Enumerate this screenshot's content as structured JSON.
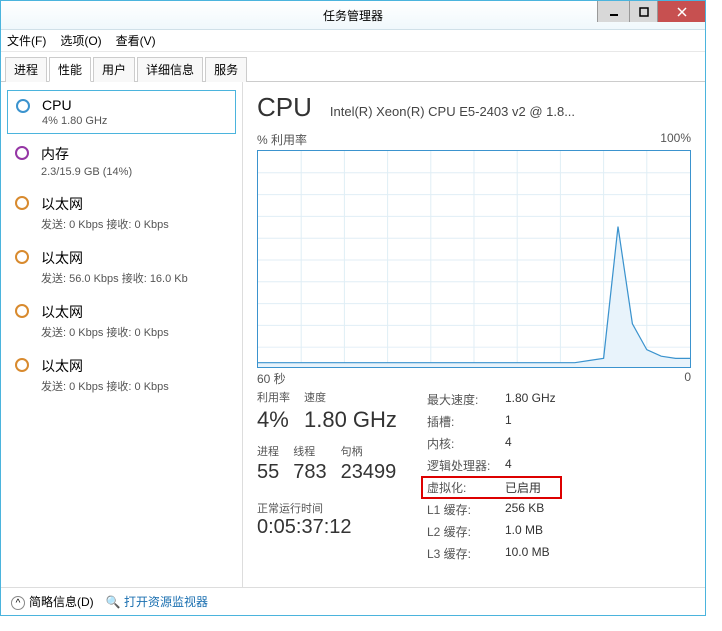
{
  "window": {
    "title": "任务管理器"
  },
  "menu": {
    "file": "文件(F)",
    "options": "选项(O)",
    "view": "查看(V)"
  },
  "tabs": {
    "processes": "进程",
    "performance": "性能",
    "users": "用户",
    "details": "详细信息",
    "services": "服务"
  },
  "sidebar": [
    {
      "title": "CPU",
      "sub": "4% 1.80 GHz",
      "iconClass": "cpu",
      "selected": true
    },
    {
      "title": "内存",
      "sub": "2.3/15.9 GB (14%)",
      "iconClass": "mem"
    },
    {
      "title": "以太网",
      "sub": "发送: 0 Kbps 接收: 0 Kbps",
      "iconClass": "eth"
    },
    {
      "title": "以太网",
      "sub": "发送: 56.0 Kbps 接收: 16.0 Kb",
      "iconClass": "eth"
    },
    {
      "title": "以太网",
      "sub": "发送: 0 Kbps 接收: 0 Kbps",
      "iconClass": "eth"
    },
    {
      "title": "以太网",
      "sub": "发送: 0 Kbps 接收: 0 Kbps",
      "iconClass": "eth"
    }
  ],
  "main": {
    "title": "CPU",
    "model": "Intel(R) Xeon(R) CPU E5-2403 v2 @ 1.8...",
    "chart_ylabel": "% 利用率",
    "chart_ymax": "100%",
    "chart_xlabel_left": "60 秒",
    "chart_xlabel_right": "0"
  },
  "stats": {
    "util_label": "利用率",
    "util": "4%",
    "speed_label": "速度",
    "speed": "1.80 GHz",
    "proc_label": "进程",
    "proc": "55",
    "threads_label": "线程",
    "threads": "783",
    "handles_label": "句柄",
    "handles": "23499",
    "uptime_label": "正常运行时间",
    "uptime": "0:05:37:12"
  },
  "info": {
    "maxspeed_k": "最大速度:",
    "maxspeed_v": "1.80 GHz",
    "sockets_k": "插槽:",
    "sockets_v": "1",
    "cores_k": "内核:",
    "cores_v": "4",
    "logical_k": "逻辑处理器:",
    "logical_v": "4",
    "virt_k": "虚拟化:",
    "virt_v": "已启用",
    "l1_k": "L1 缓存:",
    "l1_v": "256 KB",
    "l2_k": "L2 缓存:",
    "l2_v": "1.0 MB",
    "l3_k": "L3 缓存:",
    "l3_v": "10.0 MB"
  },
  "footer": {
    "brief": "简略信息(D)",
    "monitor": "打开资源监视器"
  },
  "chart_data": {
    "type": "line",
    "title": "% 利用率",
    "xlabel": "60 秒 → 0",
    "ylabel": "% 利用率",
    "ylim": [
      0,
      100
    ],
    "x_seconds_ago": [
      60,
      58,
      56,
      54,
      52,
      50,
      48,
      46,
      44,
      42,
      40,
      38,
      36,
      34,
      32,
      30,
      28,
      26,
      24,
      22,
      20,
      18,
      16,
      14,
      12,
      10,
      8,
      6,
      4,
      2,
      0
    ],
    "values": [
      2,
      2,
      2,
      2,
      2,
      2,
      2,
      2,
      2,
      2,
      2,
      2,
      2,
      2,
      2,
      2,
      2,
      2,
      2,
      2,
      2,
      2,
      2,
      3,
      4,
      65,
      20,
      8,
      5,
      4,
      4
    ]
  }
}
